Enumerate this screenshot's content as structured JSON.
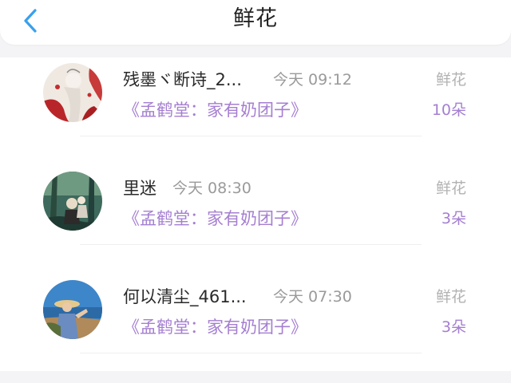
{
  "header": {
    "title": "鲜花",
    "back_icon": "chevron-left-icon"
  },
  "colors": {
    "accent": "#a57fd1",
    "back_icon": "#3aa0ec"
  },
  "records": [
    {
      "username": "残墨ヾ断诗_2...",
      "time": "今天 09:12",
      "book": "《孟鹤堂：家有奶团子》",
      "gift_type": "鲜花",
      "gift_count": "10朵"
    },
    {
      "username": "里迷",
      "time": "今天 08:30",
      "book": "《孟鹤堂：家有奶团子》",
      "gift_type": "鲜花",
      "gift_count": "3朵"
    },
    {
      "username": "何以清尘_461...",
      "time": "今天 07:30",
      "book": "《孟鹤堂：家有奶团子》",
      "gift_type": "鲜花",
      "gift_count": "3朵"
    }
  ]
}
